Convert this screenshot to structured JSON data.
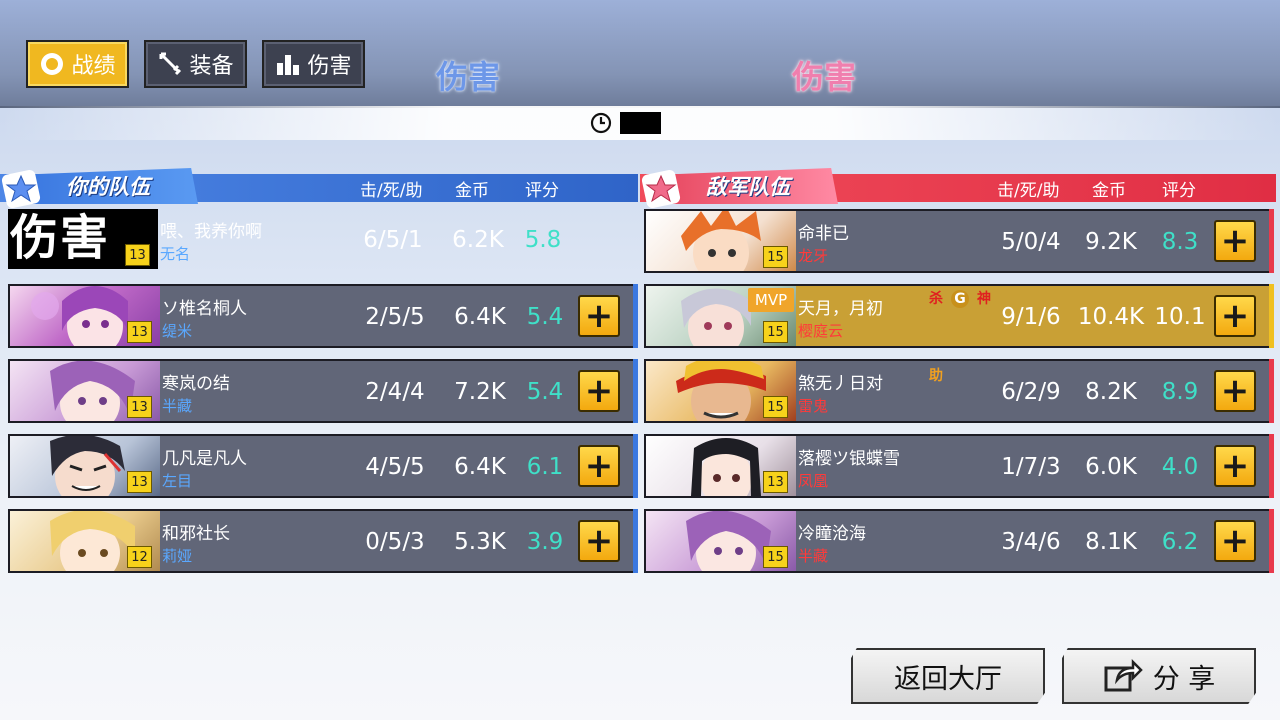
{
  "tabs": [
    {
      "label": "战绩",
      "icon": "target-icon",
      "active": true
    },
    {
      "label": "装备",
      "icon": "sword-icon",
      "active": false
    },
    {
      "label": "伤害",
      "icon": "bar-chart-icon",
      "active": false
    }
  ],
  "banner": {
    "left": "伤害",
    "right": "伤害"
  },
  "timer": {
    "value": ""
  },
  "my_team": {
    "title": "你的队伍",
    "columns": {
      "kda": "击/死/助",
      "gold": "金币",
      "score": "评分"
    },
    "players": [
      {
        "name": "喂、我养你啊",
        "hero": "无名",
        "level": "13",
        "kda": "6/5/1",
        "gold": "6.2K",
        "score": "5.8",
        "portrait_text": "伤害"
      },
      {
        "name": "ソ椎名桐人",
        "hero": "缇米",
        "level": "13",
        "kda": "2/5/5",
        "gold": "6.4K",
        "score": "5.4"
      },
      {
        "name": "寒岚の结",
        "hero": "半藏",
        "level": "13",
        "kda": "2/4/4",
        "gold": "7.2K",
        "score": "5.4"
      },
      {
        "name": "几凡是凡人",
        "hero": "左目",
        "level": "13",
        "kda": "4/5/5",
        "gold": "6.4K",
        "score": "6.1"
      },
      {
        "name": "和邪社长",
        "hero": "莉娅",
        "level": "12",
        "kda": "0/5/3",
        "gold": "5.3K",
        "score": "3.9"
      }
    ]
  },
  "enemy_team": {
    "title": "敌军队伍",
    "columns": {
      "kda": "击/死/助",
      "gold": "金币",
      "score": "评分"
    },
    "players": [
      {
        "name": "命非已",
        "hero": "龙牙",
        "level": "15",
        "kda": "5/0/4",
        "gold": "9.2K",
        "score": "8.3"
      },
      {
        "name": "天月，月初",
        "hero": "樱庭云",
        "level": "15",
        "kda": "9/1/6",
        "gold": "10.4K",
        "score": "10.1",
        "mvp": "MVP",
        "badges": [
          "杀",
          "G",
          "神"
        ]
      },
      {
        "name": "煞无丿日对",
        "hero": "雷鬼",
        "level": "15",
        "kda": "6/2/9",
        "gold": "8.2K",
        "score": "8.9",
        "badges": [
          "助"
        ]
      },
      {
        "name": "落樱ツ银蝶雪",
        "hero": "凤凰",
        "level": "13",
        "kda": "1/7/3",
        "gold": "6.0K",
        "score": "4.0"
      },
      {
        "name": "冷瞳沧海",
        "hero": "半藏",
        "level": "15",
        "kda": "3/4/6",
        "gold": "8.1K",
        "score": "6.2"
      }
    ]
  },
  "buttons": {
    "back": "返回大厅",
    "share": "分 享"
  },
  "colors": {
    "accent_yellow": "#f0b820",
    "my_team": "#4a80e0",
    "enemy_team": "#e83a4c",
    "score": "#3fe0c8",
    "my_hero_name": "#5aa8ff",
    "enemy_hero_name": "#ff3a3a"
  }
}
